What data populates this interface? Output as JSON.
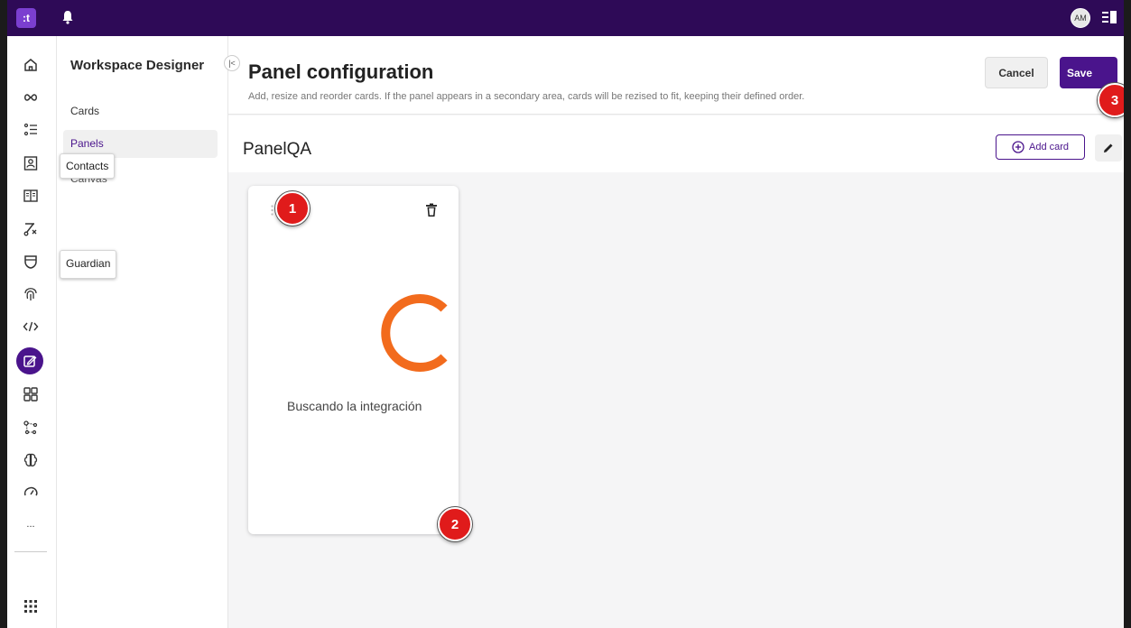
{
  "topbar": {
    "logo_text": ":t",
    "avatar_initials": "AM",
    "bar_color": "#2e0a57"
  },
  "rail": {
    "icons": [
      "home-icon",
      "infinity-icon",
      "list-icon",
      "contacts-icon",
      "book-icon",
      "routing-icon",
      "shield-icon",
      "fingerprint-icon",
      "code-icon",
      "workspace-designer-icon",
      "grid-icon",
      "network-icon",
      "brain-icon",
      "gauge-icon",
      "more-icon",
      "apps-icon"
    ],
    "more_label": "...",
    "active_color": "#4a148c"
  },
  "sidebar": {
    "title": "Workspace Designer",
    "collapse_label": "|<",
    "items": [
      {
        "label": "Cards"
      },
      {
        "label": "Panels"
      },
      {
        "label": "Canvas"
      }
    ]
  },
  "tooltips": {
    "contacts": "Contacts",
    "guardian": "Guardian"
  },
  "header": {
    "title": "Panel configuration",
    "description": "Add, resize and reorder cards. If the panel appears in a secondary area, cards will be rezised to fit, keeping their defined order.",
    "cancel_label": "Cancel",
    "save_label": "Save"
  },
  "panel": {
    "name": "PanelQA",
    "add_card_label": "Add card"
  },
  "card": {
    "loading_text": "Buscando la integración",
    "spinner_color": "#f26b1d"
  },
  "markers": [
    "1",
    "2",
    "3"
  ]
}
